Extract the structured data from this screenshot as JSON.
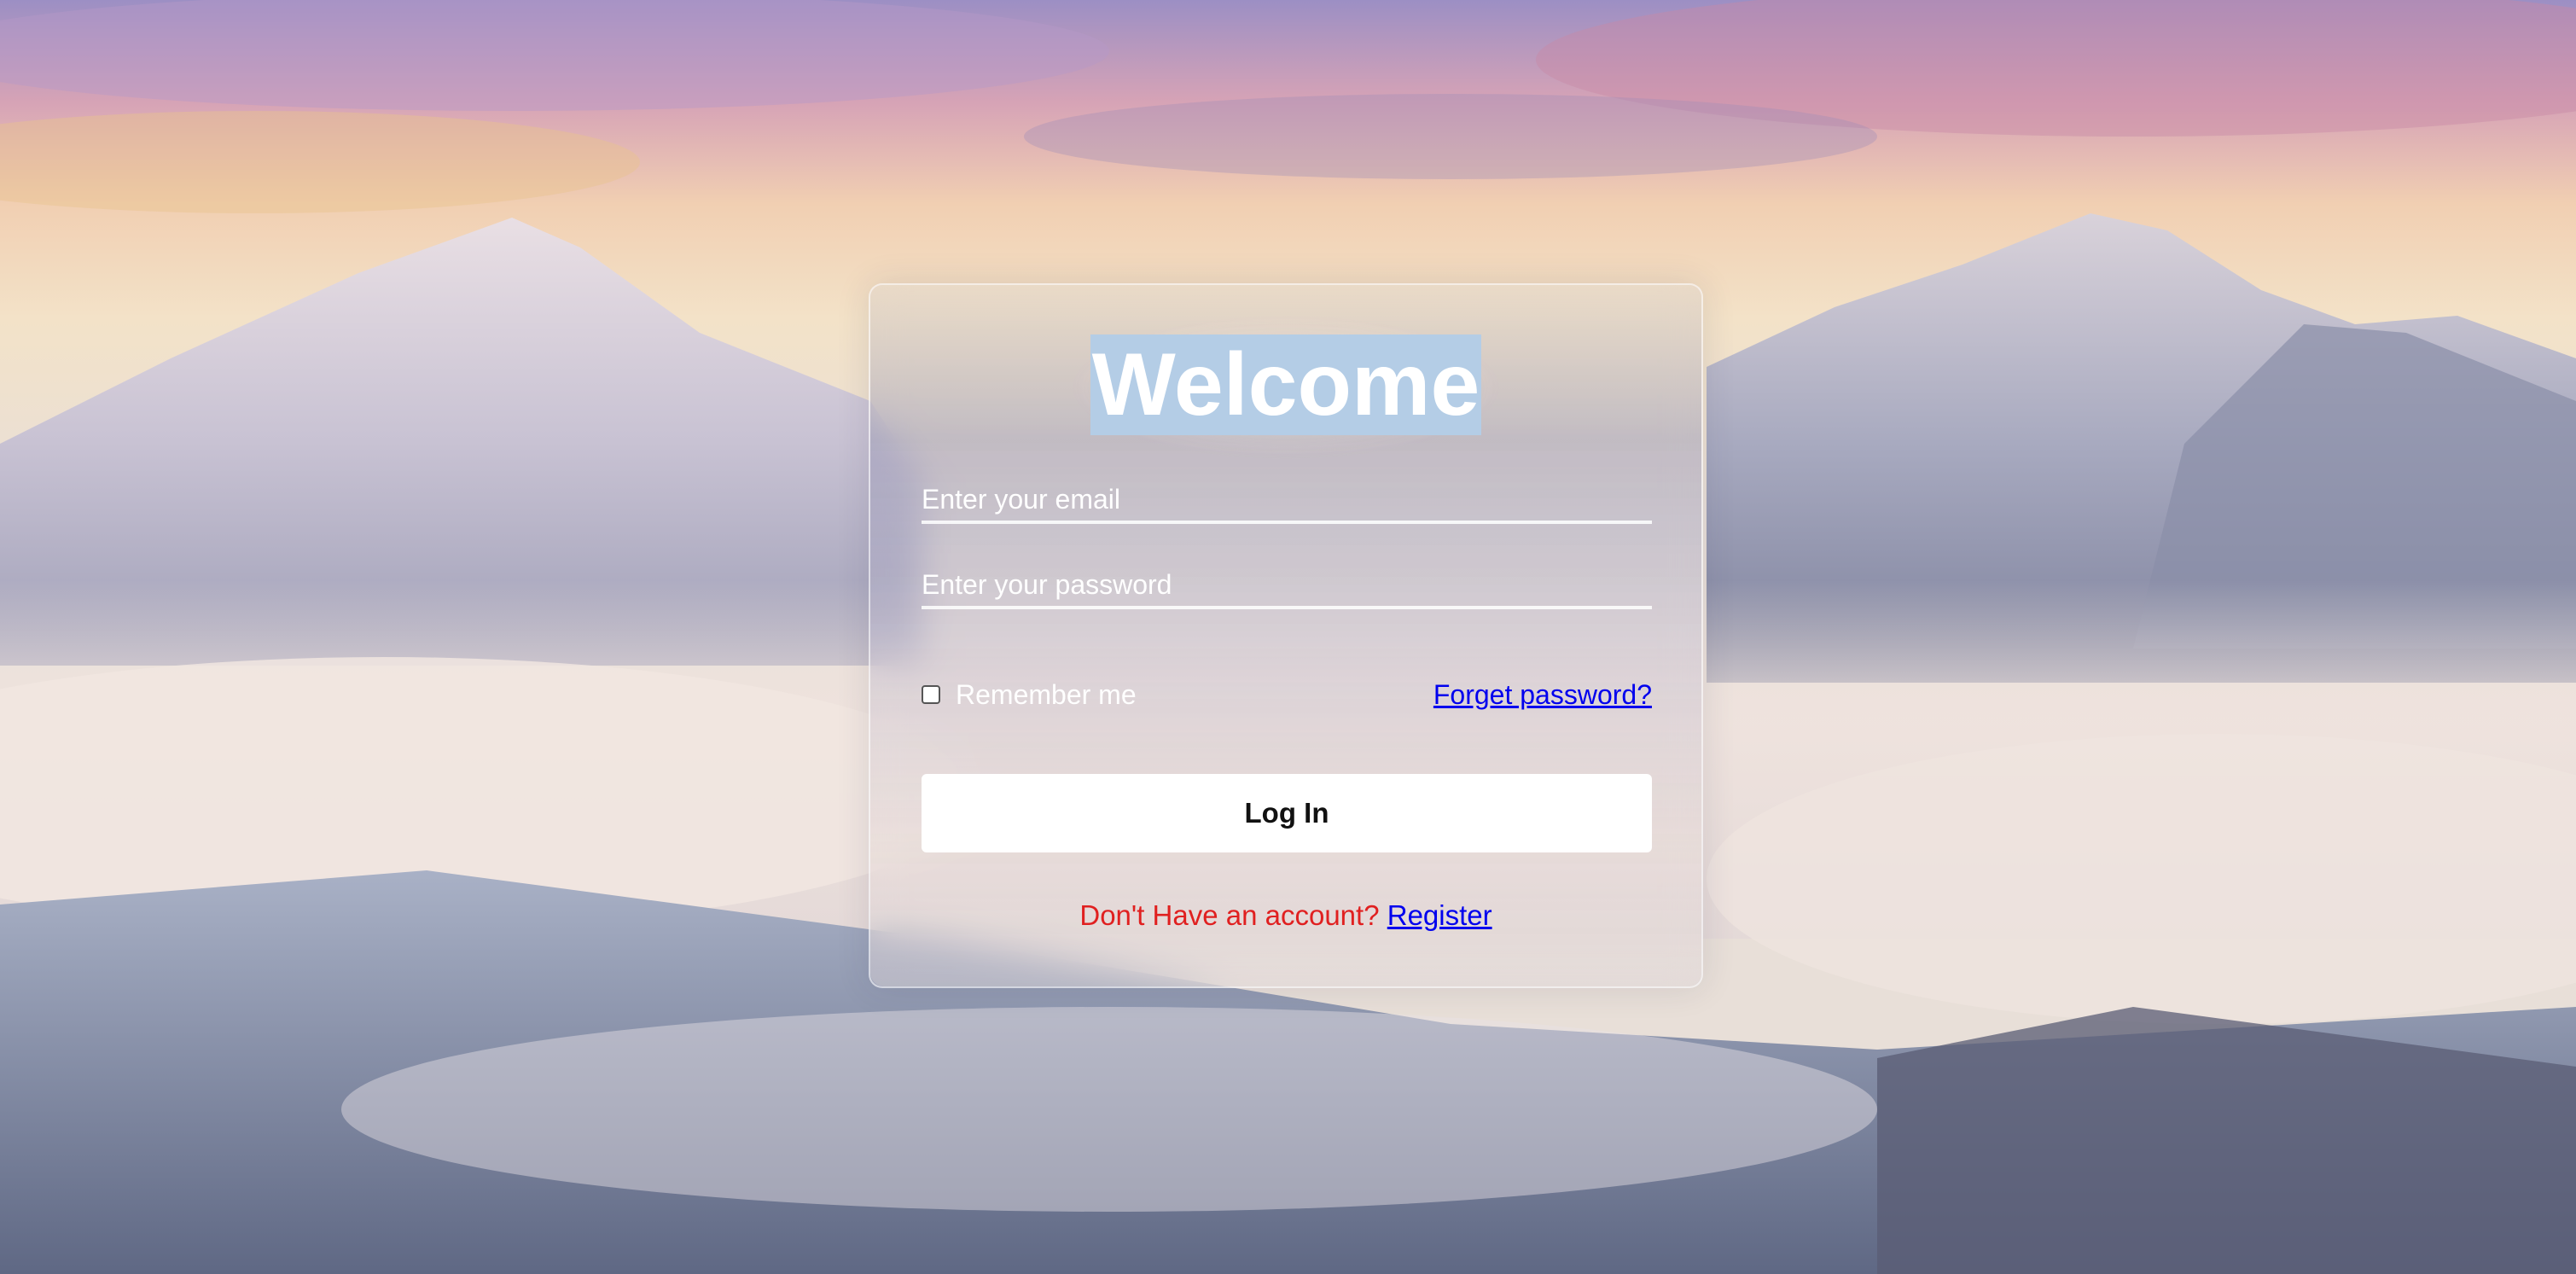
{
  "form": {
    "title": "Welcome",
    "email_placeholder": "Enter your email",
    "password_placeholder": "Enter your password",
    "remember_label": "Remember me",
    "remember_checked": false,
    "forgot_label": "Forget password?",
    "login_label": "Log In",
    "register_prompt": "Don't Have an account?",
    "register_label": "Register"
  },
  "colors": {
    "title_highlight": "#b4cde6",
    "link": "#0000ee",
    "register_prompt": "#e02020",
    "button_bg": "#ffffff"
  },
  "background": {
    "icon": "mountain-landscape-photo"
  }
}
